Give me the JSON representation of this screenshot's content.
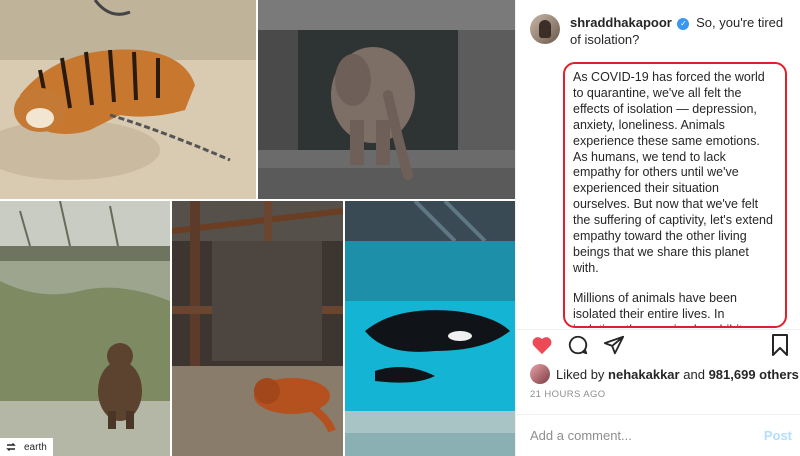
{
  "collage": {
    "repost_account": "earth"
  },
  "post": {
    "username": "shraddhakapoor",
    "caption_title": "So, you're tired of isolation?",
    "caption_paragraphs": [
      "As COVID-19 has forced the world to quarantine, we've all felt the effects of isolation — depression, anxiety, loneliness. Animals experience these same emotions. As humans, we tend to lack empathy for others until we've experienced their situation ourselves. But now that we've felt the suffering of captivity, let's extend empathy toward the other living beings that we share this planet with.",
      "Millions of animals have been isolated their entire lives. In isolation, these animals exhibit concerning behaviors including self-harm. Mental health is not a uniquely human trait. This is not"
    ],
    "likes": {
      "prefix": "Liked by",
      "user": "nehakakkar",
      "joiner": "and",
      "others": "981,699 others"
    },
    "timestamp": "21 HOURS AGO",
    "comment_placeholder": "Add a comment...",
    "post_label": "Post"
  },
  "colors": {
    "heart": "#ed4956",
    "verified": "#3897f0",
    "highlight_border": "#e0202a",
    "post_disabled": "#b2dffc"
  },
  "icons": [
    "repost-icon",
    "verified-icon",
    "heart-icon",
    "comment-icon",
    "share-icon",
    "bookmark-icon"
  ]
}
